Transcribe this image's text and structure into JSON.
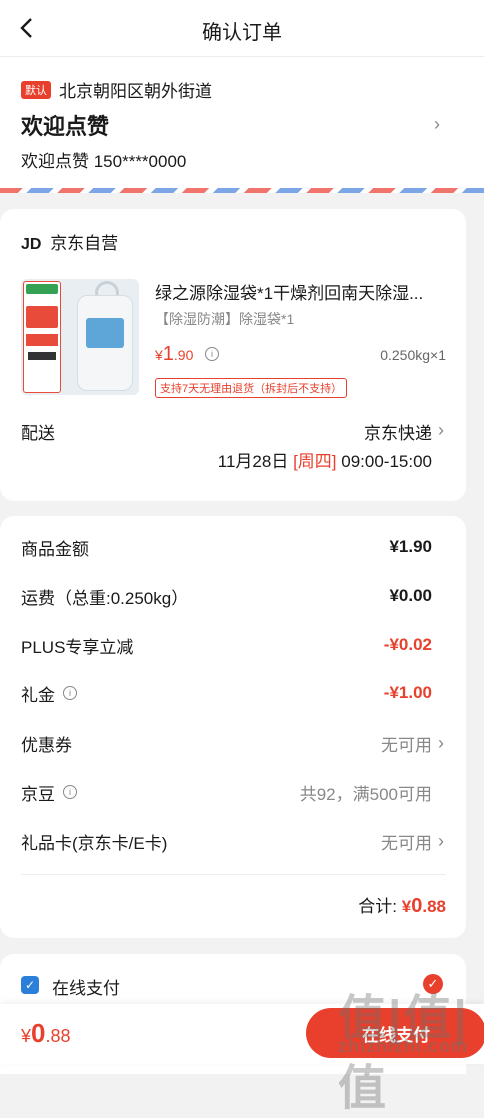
{
  "header": {
    "title": "确认订单"
  },
  "address": {
    "tag": "默认",
    "region": "北京朝阳区朝外街道",
    "name": "欢迎点赞",
    "contact": "欢迎点赞 150****0000"
  },
  "shop": {
    "logo": "JD",
    "name": "京东自营",
    "product": {
      "title": "绿之源除湿袋*1干燥剂回南天除湿...",
      "spec": "【除湿防潮】除湿袋*1",
      "price_symbol": "¥",
      "price_int": "1",
      "price_dec": ".90",
      "qty": "0.250kg×1",
      "return_tag": "支持7天无理由退货（拆封后不支持）"
    },
    "shipping": {
      "label": "配送",
      "method": "京东快递",
      "date": "11月28日",
      "weekday": "[周四]",
      "time": "09:00-15:00"
    }
  },
  "summary": {
    "rows": [
      {
        "label": "商品金额",
        "value": "¥1.90"
      },
      {
        "label": "运费（总重:0.250kg）",
        "value": "¥0.00"
      },
      {
        "label": "PLUS专享立减",
        "value": "-¥0.02"
      },
      {
        "label": "礼金",
        "value": "-¥1.00"
      },
      {
        "label": "优惠券",
        "value": "无可用"
      },
      {
        "label": "京豆",
        "value": "共92，满500可用"
      },
      {
        "label": "礼品卡(京东卡/E卡)",
        "value": "无可用"
      }
    ],
    "total_label": "合计:",
    "total_symbol": "¥",
    "total_int": "0",
    "total_dec": ".88"
  },
  "payment": {
    "method": "在线支付",
    "bottom_symbol": "¥",
    "bottom_int": "0",
    "bottom_dec": ".88",
    "pay_button": "在线支付"
  },
  "watermark": {
    "big": "值|值|值",
    "small": "zhizhizhi.com"
  },
  "colors": {
    "accent": "#e8402c",
    "pay_icon": "#2b7fd9",
    "background": "#f2f2f2"
  }
}
